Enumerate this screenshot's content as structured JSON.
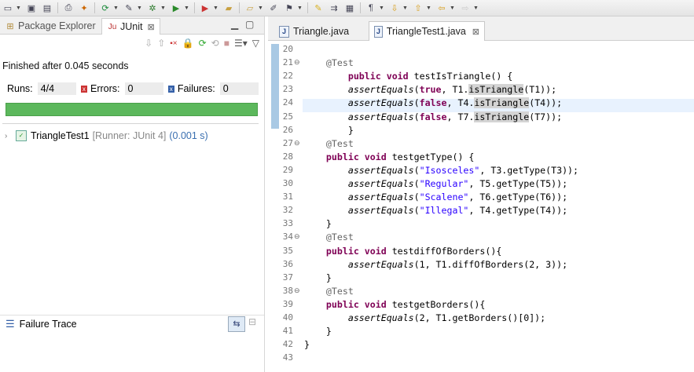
{
  "toolbar": {
    "icons": [
      "new-icon",
      "save-icon",
      "save-all-icon",
      "print-icon",
      "build-icon",
      "refresh-icon",
      "tools-icon",
      "debug-icon",
      "run-icon",
      "external-tools-icon",
      "open-folder-icon",
      "open-type-icon",
      "pen-icon",
      "annotation-icon",
      "highlight-icon",
      "toggle-icon",
      "block-icon",
      "paragraph-icon",
      "next-annotation-icon",
      "prev-annotation-icon",
      "back-icon",
      "forward-icon"
    ]
  },
  "left_panel": {
    "tabs": [
      {
        "label": "Package Explorer",
        "icon": "package-explorer-icon",
        "active": false
      },
      {
        "label": "JUnit",
        "icon": "junit-icon",
        "active": true
      }
    ],
    "close_glyph": "⊠",
    "finished_text": "Finished after 0.045 seconds",
    "counters": {
      "runs_label": "Runs:",
      "runs_value": "4/4",
      "errors_label": "Errors:",
      "errors_value": "0",
      "failures_label": "Failures:",
      "failures_value": "0"
    },
    "progress": {
      "fraction": 1.0,
      "color": "#5cb85c"
    },
    "tree": {
      "name": "TriangleTest1",
      "runner": "[Runner: JUnit 4]",
      "time": "(0.001 s)"
    },
    "failure_trace_label": "Failure Trace"
  },
  "editor": {
    "tabs": [
      {
        "label": "Triangle.java",
        "active": false
      },
      {
        "label": "TriangleTest1.java",
        "active": true
      }
    ],
    "close_glyph": "⊠",
    "lines": [
      {
        "n": "20",
        "fold": false,
        "text": ""
      },
      {
        "n": "21",
        "fold": true,
        "text": "    @Test"
      },
      {
        "n": "22",
        "fold": false,
        "text": "        public void testIsTriangle() {"
      },
      {
        "n": "23",
        "fold": false,
        "text": "        assertEquals(true, T1.isTriangle(T1));"
      },
      {
        "n": "24",
        "fold": false,
        "text": "        assertEquals(false, T4.isTriangle(T4));"
      },
      {
        "n": "25",
        "fold": false,
        "text": "        assertEquals(false, T7.isTriangle(T7));"
      },
      {
        "n": "26",
        "fold": false,
        "text": "        }"
      },
      {
        "n": "27",
        "fold": true,
        "text": "    @Test"
      },
      {
        "n": "28",
        "fold": false,
        "text": "    public void testgetType() {"
      },
      {
        "n": "29",
        "fold": false,
        "text": "        assertEquals(\"Isosceles\", T3.getType(T3));"
      },
      {
        "n": "30",
        "fold": false,
        "text": "        assertEquals(\"Regular\", T5.getType(T5));"
      },
      {
        "n": "31",
        "fold": false,
        "text": "        assertEquals(\"Scalene\", T6.getType(T6));"
      },
      {
        "n": "32",
        "fold": false,
        "text": "        assertEquals(\"Illegal\", T4.getType(T4));"
      },
      {
        "n": "33",
        "fold": false,
        "text": "    }"
      },
      {
        "n": "34",
        "fold": true,
        "text": "    @Test"
      },
      {
        "n": "35",
        "fold": false,
        "text": "    public void testdiffOfBorders(){"
      },
      {
        "n": "36",
        "fold": false,
        "text": "        assertEquals(1, T1.diffOfBorders(2, 3));"
      },
      {
        "n": "37",
        "fold": false,
        "text": "    }"
      },
      {
        "n": "38",
        "fold": true,
        "text": "    @Test"
      },
      {
        "n": "39",
        "fold": false,
        "text": "    public void testgetBorders(){"
      },
      {
        "n": "40",
        "fold": false,
        "text": "        assertEquals(2, T1.getBorders()[0]);"
      },
      {
        "n": "41",
        "fold": false,
        "text": "    }"
      },
      {
        "n": "42",
        "fold": false,
        "text": "}"
      },
      {
        "n": "43",
        "fold": false,
        "text": ""
      }
    ]
  }
}
